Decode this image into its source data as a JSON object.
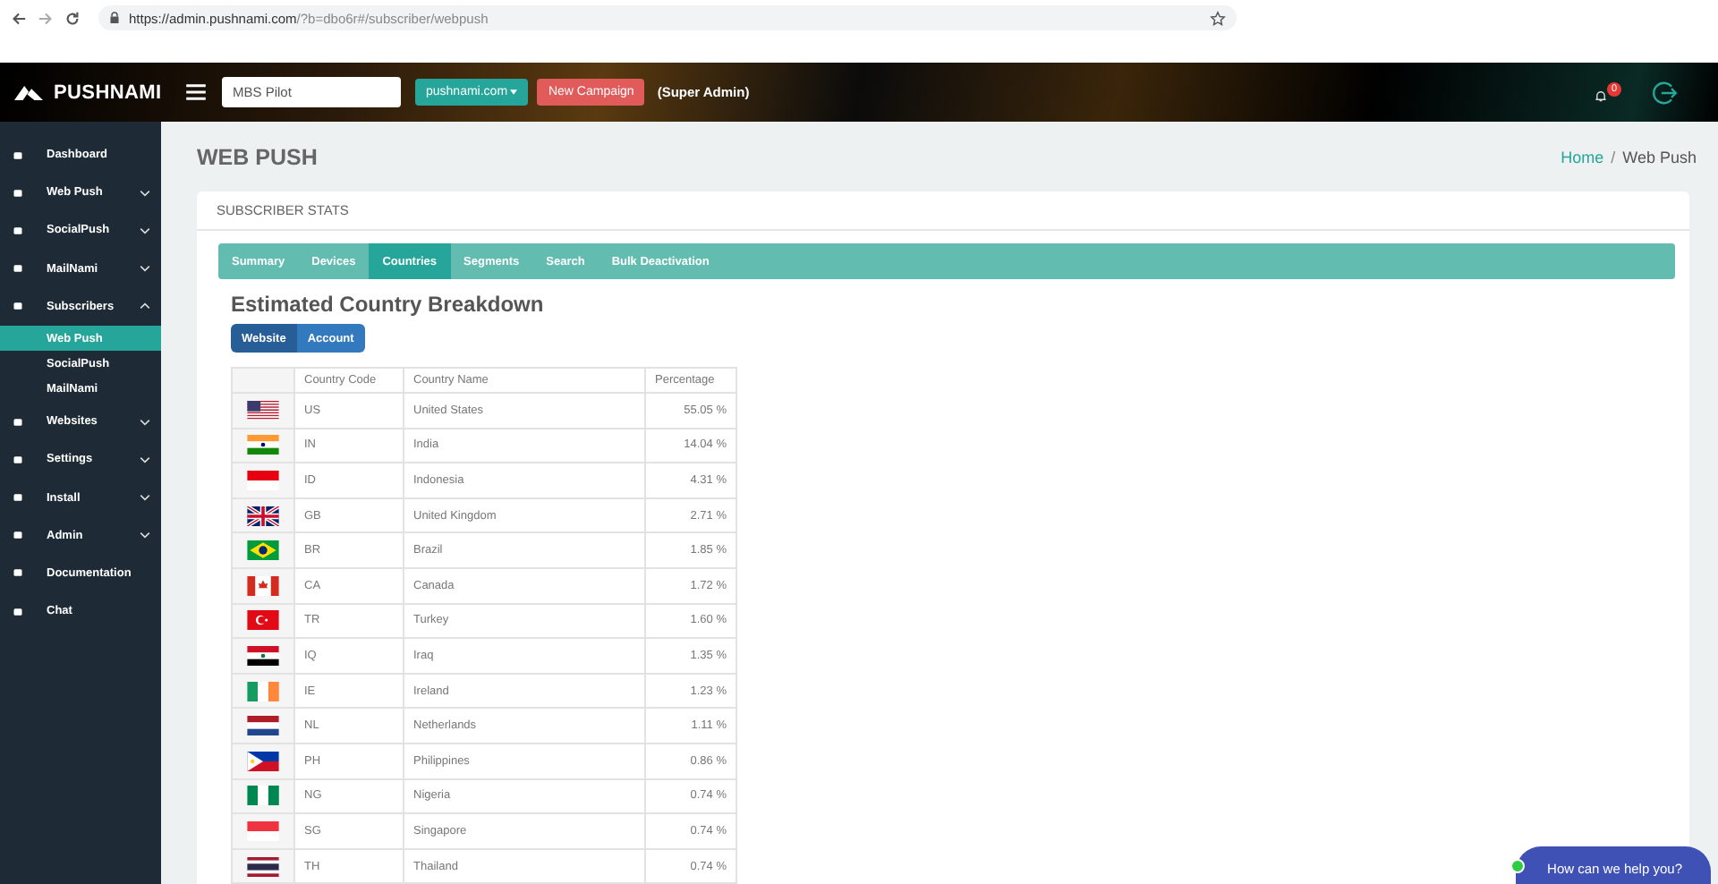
{
  "browser": {
    "url_host": "https://admin.pushnami.com",
    "url_path": "/?b=dbo6r#/subscriber/webpush"
  },
  "header": {
    "logo": "PUSHNAMI",
    "site_field": {
      "value": "MBS Pilot"
    },
    "domain_button": "pushnami.com",
    "new_campaign_button": "New Campaign",
    "role": "(Super Admin)",
    "notification_count": "0"
  },
  "sidebar": {
    "items": [
      {
        "label": "Dashboard",
        "kind": "link"
      },
      {
        "label": "Web Push",
        "kind": "group",
        "expanded": false
      },
      {
        "label": "SocialPush",
        "kind": "group",
        "expanded": false
      },
      {
        "label": "MailNami",
        "kind": "group",
        "expanded": false
      },
      {
        "label": "Subscribers",
        "kind": "group",
        "expanded": true,
        "children": [
          {
            "label": "Web Push",
            "selected": true
          },
          {
            "label": "SocialPush",
            "selected": false
          },
          {
            "label": "MailNami",
            "selected": false
          }
        ]
      },
      {
        "label": "Websites",
        "kind": "group",
        "expanded": false
      },
      {
        "label": "Settings",
        "kind": "group",
        "expanded": false
      },
      {
        "label": "Install",
        "kind": "group",
        "expanded": false
      },
      {
        "label": "Admin",
        "kind": "group",
        "expanded": false
      },
      {
        "label": "Documentation",
        "kind": "link"
      },
      {
        "label": "Chat",
        "kind": "link"
      }
    ]
  },
  "page": {
    "title": "WEB PUSH",
    "breadcrumb_separator": "/",
    "breadcrumbs": [
      {
        "label": "Home",
        "link": true
      },
      {
        "label": "Web Push",
        "link": false
      }
    ]
  },
  "panel": {
    "title": "SUBSCRIBER STATS",
    "tabs": [
      {
        "label": "Summary",
        "selected": false
      },
      {
        "label": "Devices",
        "selected": false
      },
      {
        "label": "Countries",
        "selected": true
      },
      {
        "label": "Segments",
        "selected": false
      },
      {
        "label": "Search",
        "selected": false
      },
      {
        "label": "Bulk Deactivation",
        "selected": false
      }
    ],
    "heading": "Estimated Country Breakdown",
    "toggle": [
      {
        "label": "Website",
        "selected": true
      },
      {
        "label": "Account",
        "selected": false
      }
    ],
    "table": {
      "columns": [
        "Country Code",
        "Country Name",
        "Percentage"
      ],
      "rows": [
        {
          "code": "US",
          "name": "United States",
          "percentage": "55.05 %"
        },
        {
          "code": "IN",
          "name": "India",
          "percentage": "14.04 %"
        },
        {
          "code": "ID",
          "name": "Indonesia",
          "percentage": "4.31 %"
        },
        {
          "code": "GB",
          "name": "United Kingdom",
          "percentage": "2.71 %"
        },
        {
          "code": "BR",
          "name": "Brazil",
          "percentage": "1.85 %"
        },
        {
          "code": "CA",
          "name": "Canada",
          "percentage": "1.72 %"
        },
        {
          "code": "TR",
          "name": "Turkey",
          "percentage": "1.60 %"
        },
        {
          "code": "IQ",
          "name": "Iraq",
          "percentage": "1.35 %"
        },
        {
          "code": "IE",
          "name": "Ireland",
          "percentage": "1.23 %"
        },
        {
          "code": "NL",
          "name": "Netherlands",
          "percentage": "1.11 %"
        },
        {
          "code": "PH",
          "name": "Philippines",
          "percentage": "0.86 %"
        },
        {
          "code": "NG",
          "name": "Nigeria",
          "percentage": "0.74 %"
        },
        {
          "code": "SG",
          "name": "Singapore",
          "percentage": "0.74 %"
        },
        {
          "code": "TH",
          "name": "Thailand",
          "percentage": "0.74 %"
        }
      ]
    }
  },
  "chat_widget": {
    "label": "How can we help you?"
  }
}
